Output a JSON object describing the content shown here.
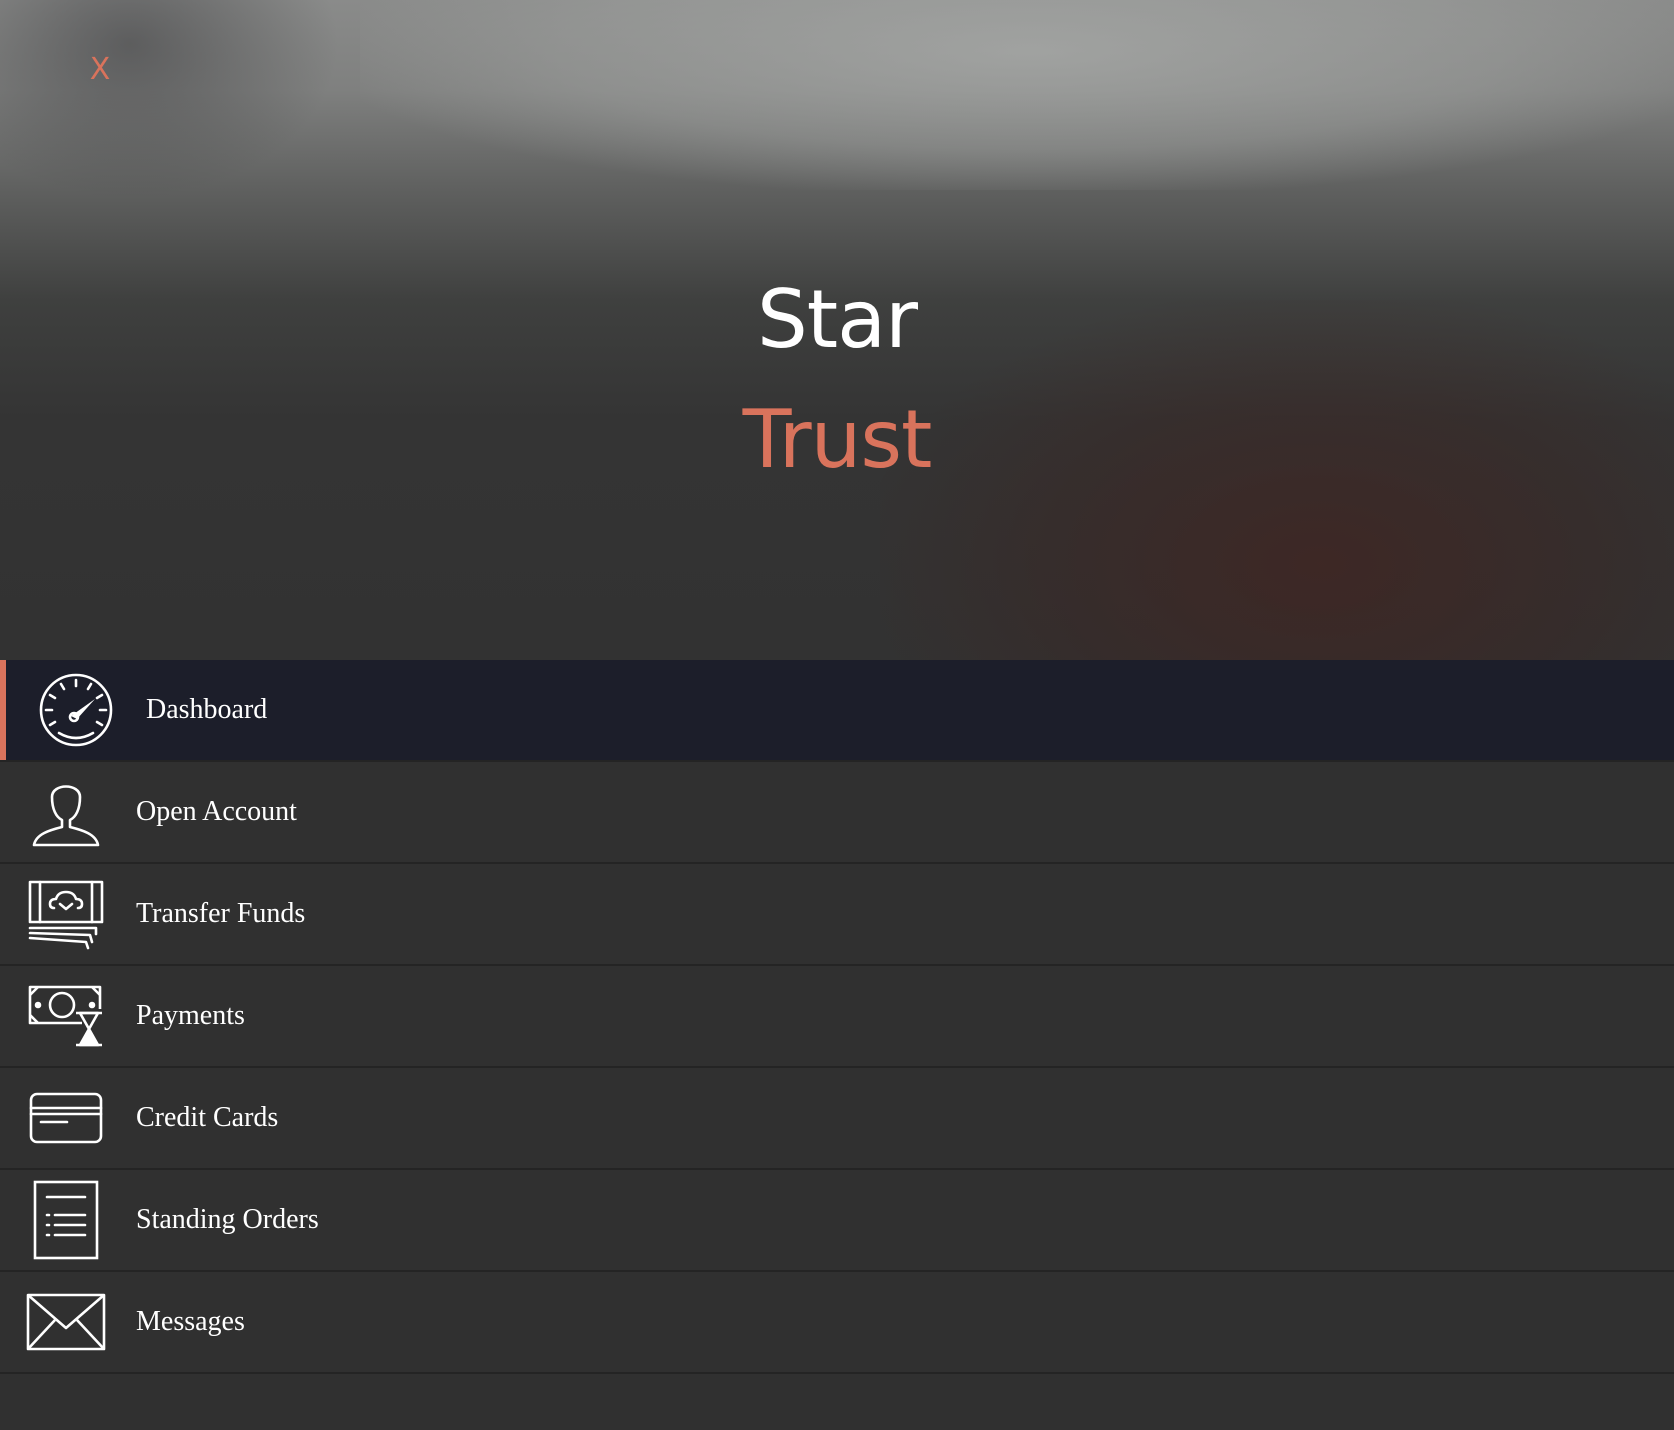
{
  "header": {
    "close_label": "X",
    "brand_line1": "Star",
    "brand_line2": "Trust"
  },
  "colors": {
    "accent": "#d9735c",
    "active_bg": "#1c1e2a",
    "menu_bg": "#303030"
  },
  "menu": {
    "items": [
      {
        "label": "Dashboard",
        "icon": "speedometer-icon",
        "active": true
      },
      {
        "label": "Open Account",
        "icon": "user-icon",
        "active": false
      },
      {
        "label": "Transfer Funds",
        "icon": "money-transfer-icon",
        "active": false
      },
      {
        "label": "Payments",
        "icon": "payment-hourglass-icon",
        "active": false
      },
      {
        "label": "Credit Cards",
        "icon": "credit-card-icon",
        "active": false
      },
      {
        "label": "Standing Orders",
        "icon": "document-list-icon",
        "active": false
      },
      {
        "label": "Messages",
        "icon": "envelope-icon",
        "active": false
      }
    ]
  }
}
